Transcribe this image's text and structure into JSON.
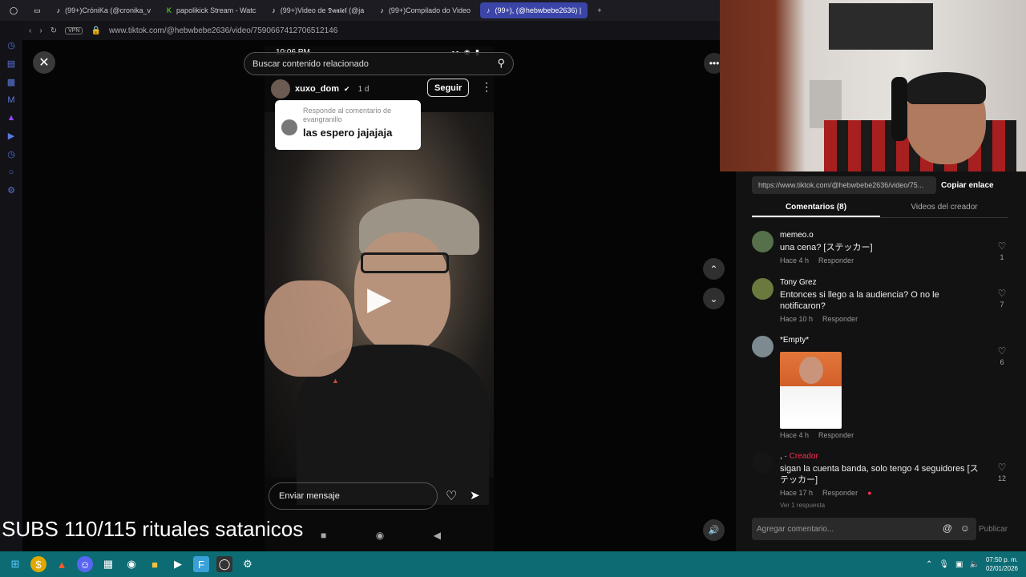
{
  "browser": {
    "tabs": [
      {
        "label": "(99+)CróniKa (@cronika_v",
        "active": false
      },
      {
        "label": "papolikick Stream - Watc",
        "active": false
      },
      {
        "label": "(99+)Video de 𝕯𝖆𝖓𝖎𝖊𝖑 (@ja",
        "active": false
      },
      {
        "label": "(99+)Compilado do Video",
        "active": false
      },
      {
        "label": "(99+), (@hebwbebe2636) |",
        "active": true
      }
    ],
    "new_tab": "+",
    "vpn": "VPN",
    "url": "www.tiktok.com/@hebwbebe2636/video/7590667412706512146"
  },
  "player": {
    "search_placeholder": "Buscar contenido relacionado",
    "phone": {
      "time": "10:06 PM",
      "author": "xuxo_dom",
      "posted": "1 d",
      "follow": "Seguir",
      "reply_label": "Responde al comentario de evangranillo",
      "reply_text": "las espero jajajaja",
      "message_placeholder": "Enviar mensaje"
    }
  },
  "overlay": {
    "subs_text": "SUBS 110/115 rituales satanicos"
  },
  "panel": {
    "link": "https://www.tiktok.com/@hebwbebe2636/video/75...",
    "copy": "Copiar enlace",
    "tab_comments": "Comentarios (8)",
    "tab_creator": "Videos del creador",
    "comments": [
      {
        "user": "memeo.o",
        "text": "una cena? [ステッカー]",
        "time": "Hace 4 h",
        "reply": "Responder",
        "likes": "1"
      },
      {
        "user": "Tony Grez",
        "text": "Entonces si llego a la audiencia? O no le notificaron?",
        "time": "Hace 10 h",
        "reply": "Responder",
        "likes": "7"
      },
      {
        "user": "*Empty*",
        "text": "",
        "time": "Hace 4 h",
        "reply": "Responder",
        "likes": "6"
      },
      {
        "user": ", ·",
        "creator_tag": "Creador",
        "text": "sigan la cuenta banda, solo tengo 4 seguidores [ステッカー]",
        "time": "Hace 17 h",
        "reply": "Responder",
        "likes": "12"
      }
    ],
    "replies_peek": "Ver 1 respuesta",
    "add_comment_placeholder": "Agregar comentario...",
    "publish": "Publicar"
  },
  "taskbar": {
    "time": "07:50 p. m.",
    "date": "02/01/2026"
  }
}
